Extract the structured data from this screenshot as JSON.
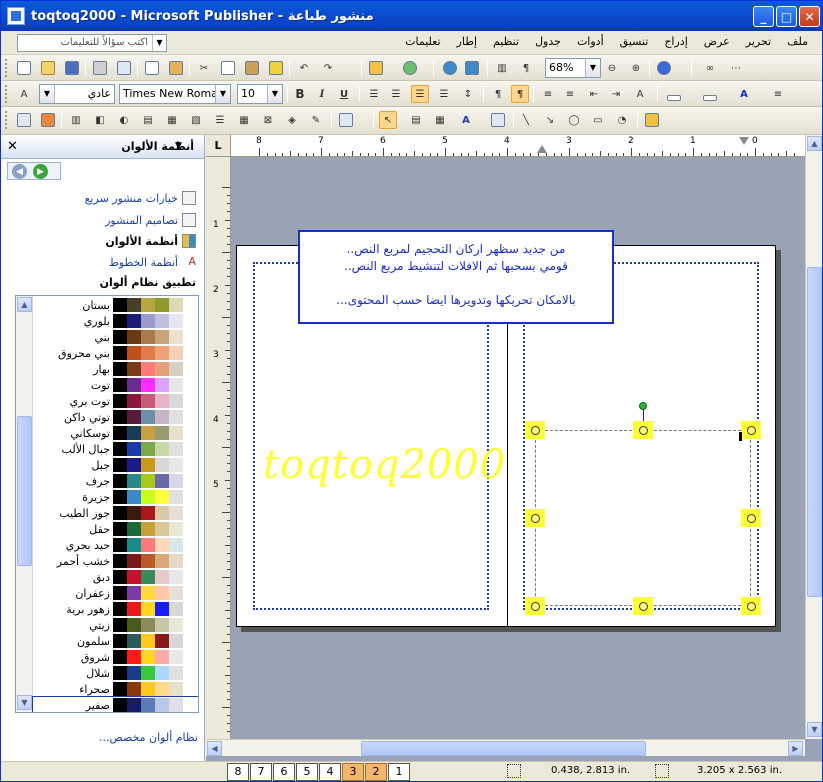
{
  "window": {
    "title": "toqtoq2000 - Microsoft Publisher - منشور طباعة",
    "min_glyph": "_",
    "max_glyph": "□",
    "close_glyph": "✕"
  },
  "menubar": {
    "help_placeholder": "اكتب سؤالاً للتعليمات",
    "items": [
      "ملف",
      "تحرير",
      "عرض",
      "إدراج",
      "تنسيق",
      "أدوات",
      "جدول",
      "تنظيم",
      "إطار",
      "تعليمات"
    ]
  },
  "toolbar_standard": {
    "zoom": "68%"
  },
  "toolbar_format": {
    "style": "عادي",
    "font": "Times New Roman",
    "size": "10",
    "bold": "B",
    "italic": "I",
    "underline": "U"
  },
  "taskpane": {
    "title": "أنظمة الألوان",
    "links": [
      {
        "label": "خيارات منشور سريع",
        "bold": false
      },
      {
        "label": "تصاميم المنشور",
        "bold": false
      },
      {
        "label": "أنظمة الألوان",
        "bold": true
      },
      {
        "label": "أنظمة الخطوط",
        "bold": false
      }
    ],
    "apply_label": "تطبيق نظام ألوان",
    "custom_link": "نظام ألوان مخصص...",
    "schemes": [
      {
        "name": "بستان",
        "colors": [
          "#000000",
          "#4a3d2a",
          "#b5a642",
          "#8f9a2c",
          "#dcd8b8"
        ]
      },
      {
        "name": "بلوري",
        "colors": [
          "#000000",
          "#1b1b7a",
          "#9a9acb",
          "#c0c0e0",
          "#e6e6f2"
        ]
      },
      {
        "name": "بني",
        "colors": [
          "#000000",
          "#6b3a12",
          "#a97a4c",
          "#c8a37a",
          "#ede1cd"
        ]
      },
      {
        "name": "بني محروق",
        "colors": [
          "#000000",
          "#c0501a",
          "#e07b47",
          "#f0a277",
          "#f5d0b8"
        ]
      },
      {
        "name": "بهار",
        "colors": [
          "#000000",
          "#7a3b1a",
          "#ff7b7b",
          "#e5a07a",
          "#d9d0c4"
        ]
      },
      {
        "name": "توت",
        "colors": [
          "#000000",
          "#6a2c91",
          "#ff2bff",
          "#d9a3ff",
          "#e6e6e6"
        ]
      },
      {
        "name": "توت بري",
        "colors": [
          "#000000",
          "#8a1a3a",
          "#c85a7a",
          "#e8b3c8",
          "#d9d9d9"
        ]
      },
      {
        "name": "توتي داكن",
        "colors": [
          "#000000",
          "#5a1a3a",
          "#6b8fa8",
          "#c8b3c8",
          "#e0e0e0"
        ]
      },
      {
        "name": "توسكاني",
        "colors": [
          "#000000",
          "#1a3a5a",
          "#c8a040",
          "#9a9a70",
          "#e8e0c8"
        ]
      },
      {
        "name": "جبال الألب",
        "colors": [
          "#000000",
          "#1a3aa8",
          "#7aa84a",
          "#c8d8a8",
          "#e0e0e0"
        ]
      },
      {
        "name": "جبل",
        "colors": [
          "#000000",
          "#1a1a8a",
          "#c89a1a",
          "#d8d8d8",
          "#e8e8e8"
        ]
      },
      {
        "name": "جرف",
        "colors": [
          "#000000",
          "#2a8a8a",
          "#a8c81a",
          "#6a6aa8",
          "#d8d8e8"
        ]
      },
      {
        "name": "جزيرة",
        "colors": [
          "#000000",
          "#3a8ac8",
          "#c8ff1a",
          "#ffff3a",
          "#e0e0e0"
        ]
      },
      {
        "name": "جوز الطيب",
        "colors": [
          "#000000",
          "#3a1a0a",
          "#a81a1a",
          "#d8c8a8",
          "#e8e0d8"
        ]
      },
      {
        "name": "حقل",
        "colors": [
          "#000000",
          "#1a6a3a",
          "#c8a03a",
          "#d8c89a",
          "#e8e8d8"
        ]
      },
      {
        "name": "حيد بحري",
        "colors": [
          "#000000",
          "#1a8a8a",
          "#ff7a7a",
          "#ffd8b8",
          "#d8e8e8"
        ]
      },
      {
        "name": "خشب أحمر",
        "colors": [
          "#000000",
          "#7a1a1a",
          "#b85a2a",
          "#d8a87a",
          "#e8d8c8"
        ]
      },
      {
        "name": "دبق",
        "colors": [
          "#000000",
          "#c8102e",
          "#3a8a5a",
          "#e8c8c8",
          "#e8e8e8"
        ]
      },
      {
        "name": "زعفران",
        "colors": [
          "#000000",
          "#7a3aa8",
          "#ffd83a",
          "#ffc8a8",
          "#e8e0d8"
        ]
      },
      {
        "name": "زهور برية",
        "colors": [
          "#000000",
          "#e81a1a",
          "#ffd81a",
          "#1a1aff",
          "#d8d8d8"
        ]
      },
      {
        "name": "زيتي",
        "colors": [
          "#000000",
          "#4a5a1a",
          "#8a8a5a",
          "#c8c8a8",
          "#e8e8d8"
        ]
      },
      {
        "name": "سلمون",
        "colors": [
          "#000000",
          "#2a5a5a",
          "#ffc81a",
          "#8a1a1a",
          "#d8d8d8"
        ]
      },
      {
        "name": "شروق",
        "colors": [
          "#000000",
          "#ff1a1a",
          "#ffd81a",
          "#ffa8a8",
          "#e8e8e8"
        ]
      },
      {
        "name": "شلال",
        "colors": [
          "#000000",
          "#1a3a8a",
          "#3ac83a",
          "#a8d8ff",
          "#e0e0e0"
        ]
      },
      {
        "name": "صحراء",
        "colors": [
          "#000000",
          "#8a3a0a",
          "#ffc81a",
          "#ffd88a",
          "#e8e0c8"
        ]
      },
      {
        "name": "صفير",
        "colors": [
          "#000000",
          "#1a1a6a",
          "#5a7ab8",
          "#b8c8e8",
          "#e0e0e8"
        ]
      }
    ],
    "selected_scheme": "صفير"
  },
  "workspace": {
    "ruler_corner": "L",
    "hruler_numbers": [
      "8",
      "7",
      "6",
      "5",
      "4",
      "3",
      "2",
      "1",
      "0"
    ],
    "vruler_numbers": [
      "1",
      "2",
      "3",
      "4",
      "5"
    ],
    "watermark": "toqtoq2000",
    "callout_lines": [
      "من جديد سظهر اركان التحجيم لمربع النص..",
      "قومي بسحبها ثم الافلات لتنشيط مربع النص..",
      "",
      "بالامكان تحريكها وتدويرها ايضا حسب المحتوى..."
    ]
  },
  "statusbar": {
    "pages": [
      "8",
      "7",
      "6",
      "5",
      "4",
      "3",
      "2",
      "1"
    ],
    "current_pages": [
      "3",
      "2"
    ],
    "position": "0.438, 2.813 in.",
    "size": "3.205 x 2.563 in."
  }
}
